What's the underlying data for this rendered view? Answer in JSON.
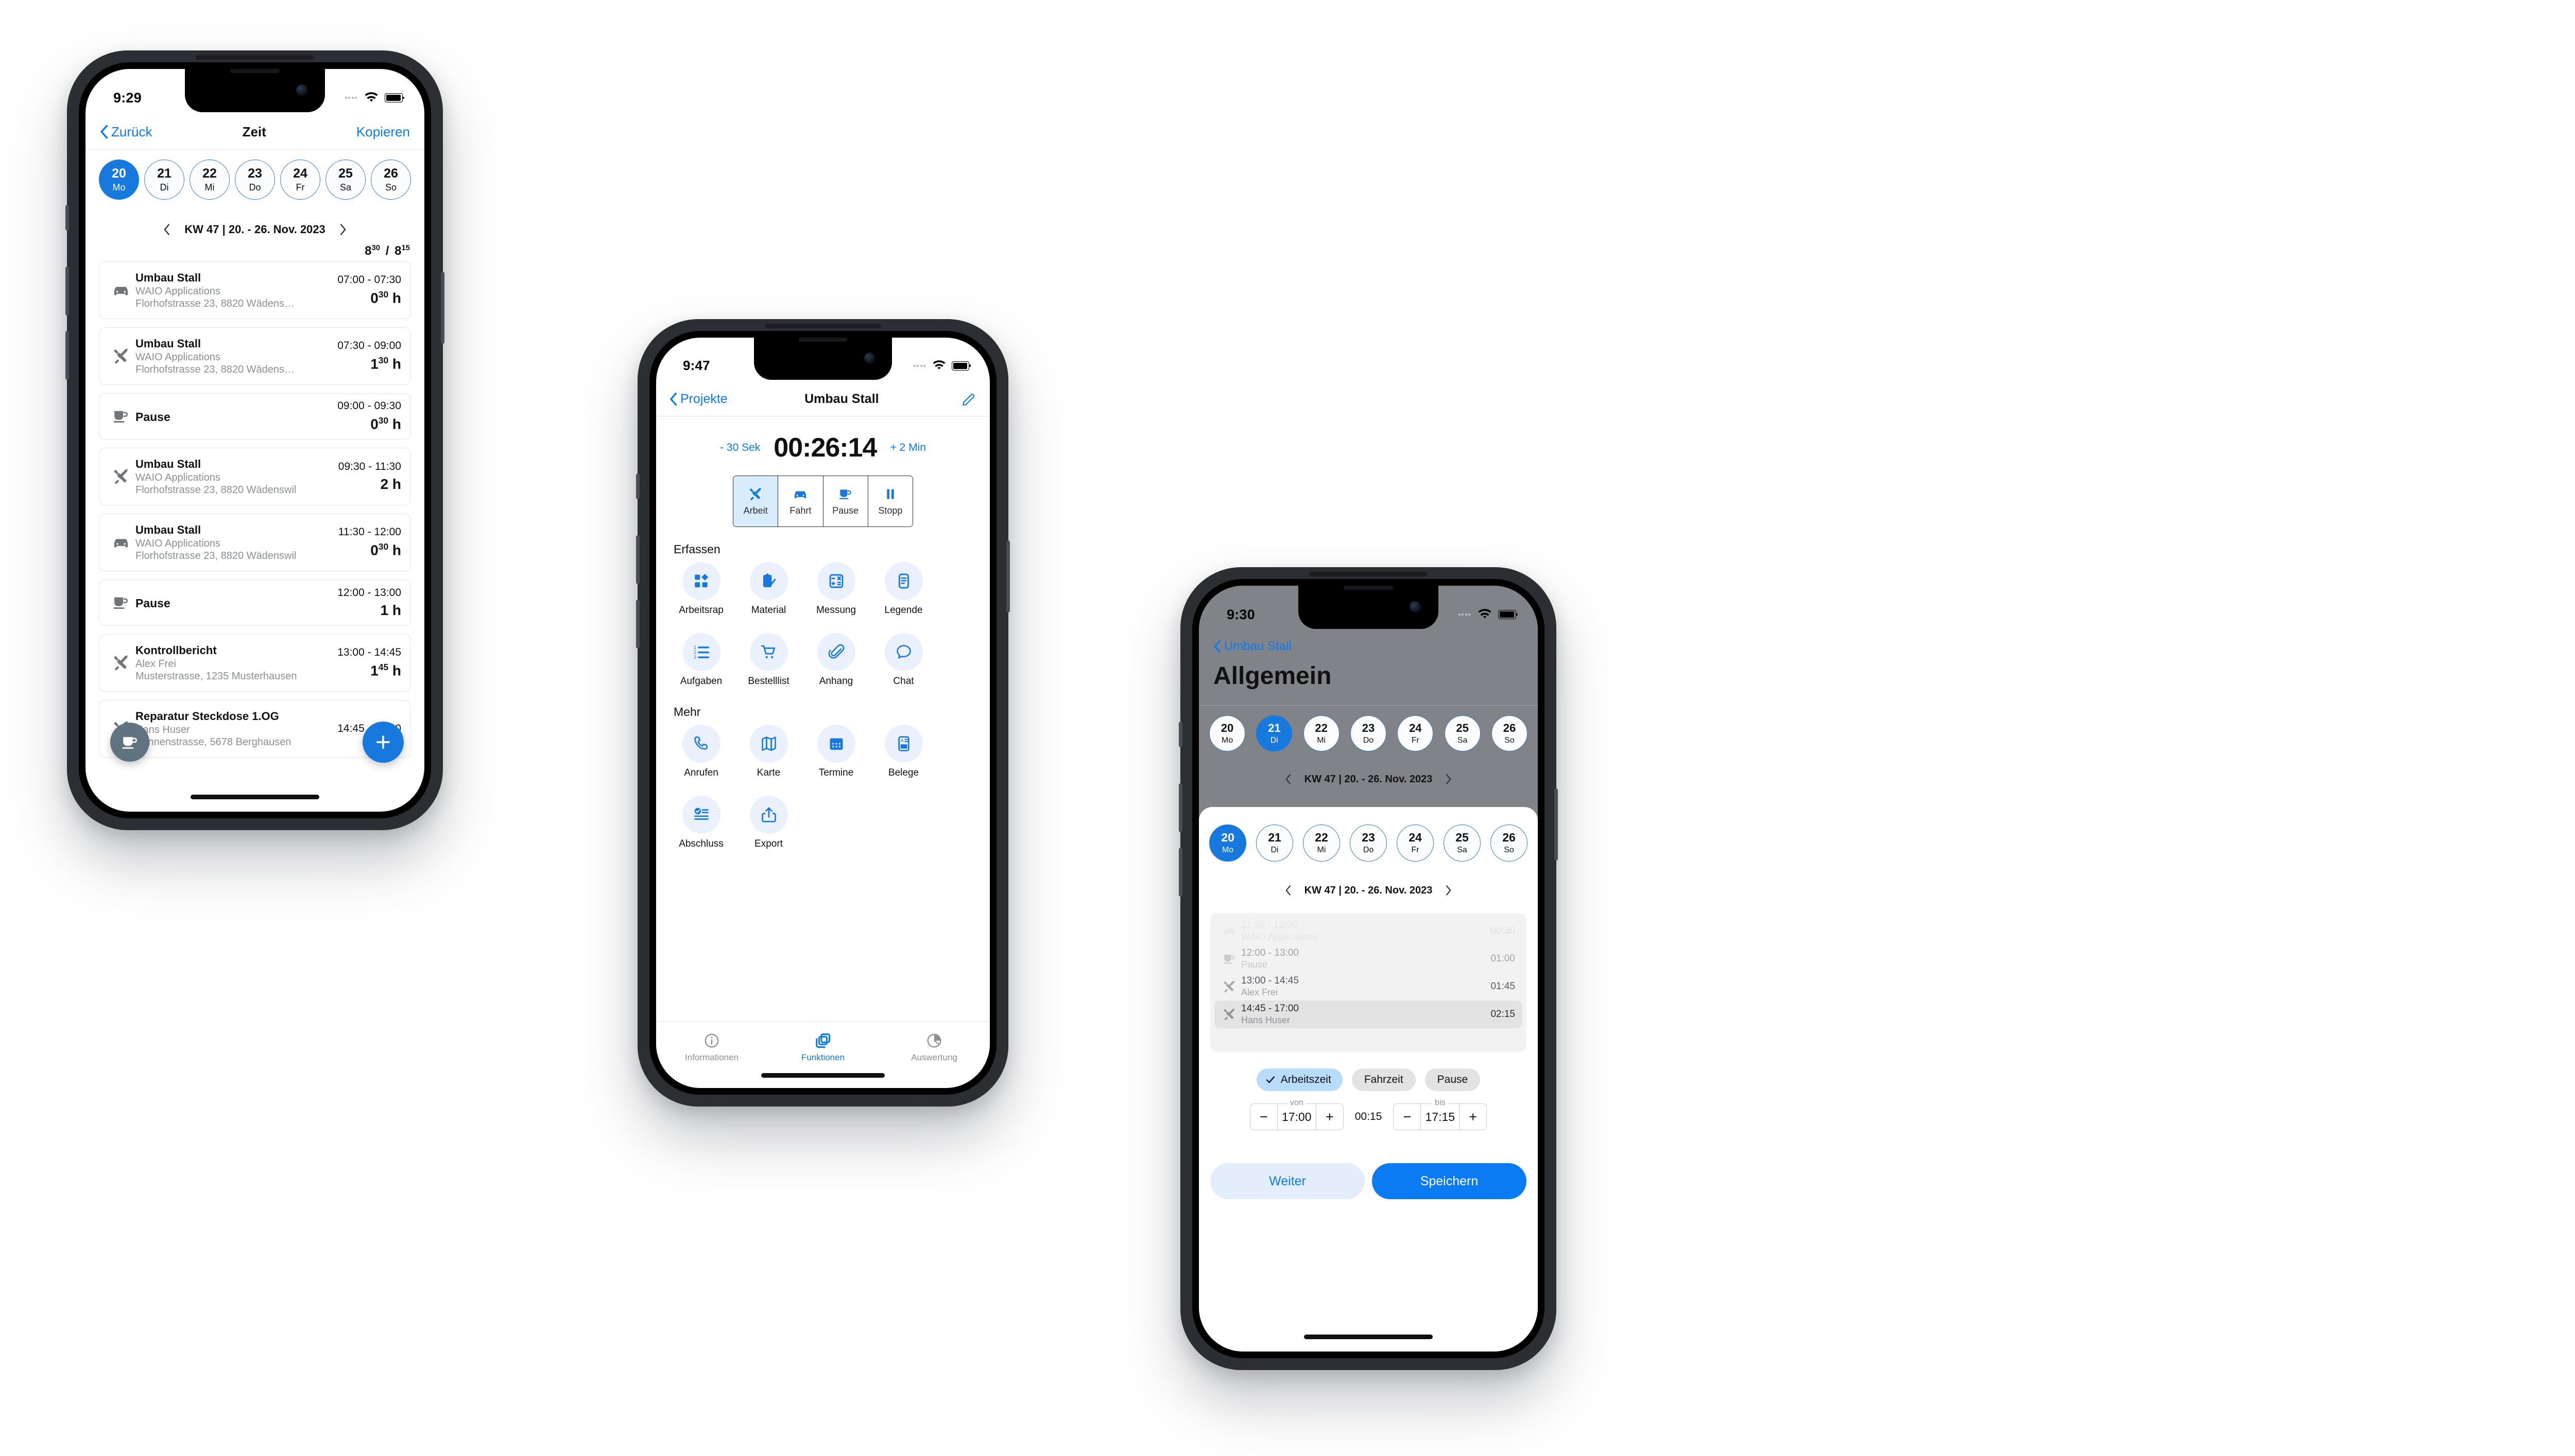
{
  "phone1": {
    "status": {
      "time": "9:29"
    },
    "nav": {
      "back": "Zurück",
      "title": "Zeit",
      "action": "Kopieren"
    },
    "days": [
      {
        "num": "20",
        "wd": "Mo",
        "active": true
      },
      {
        "num": "21",
        "wd": "Di",
        "active": false
      },
      {
        "num": "22",
        "wd": "Mi",
        "active": false
      },
      {
        "num": "23",
        "wd": "Do",
        "active": false
      },
      {
        "num": "24",
        "wd": "Fr",
        "active": false
      },
      {
        "num": "25",
        "wd": "Sa",
        "active": false
      },
      {
        "num": "26",
        "wd": "So",
        "active": false
      }
    ],
    "week": "KW 47 | 20. - 26. Nov. 2023",
    "summary": {
      "actual": "8",
      "actual_sup": "30",
      "sep": "/",
      "target": "8",
      "target_sup": "15"
    },
    "entries": [
      {
        "icon": "car-icon",
        "title": "Umbau Stall",
        "sub": "WAIO Applications",
        "addr": "Florhofstrasse 23, 8820 Wädens…",
        "range": "07:00 - 07:30",
        "dur": "0",
        "dur_sup": "30",
        "unit": "h"
      },
      {
        "icon": "tools-icon",
        "title": "Umbau Stall",
        "sub": "WAIO Applications",
        "addr": "Florhofstrasse 23, 8820 Wädens…",
        "range": "07:30 - 09:00",
        "dur": "1",
        "dur_sup": "30",
        "unit": "h"
      },
      {
        "icon": "cup-icon",
        "title": "Pause",
        "sub": "",
        "addr": "",
        "range": "09:00 - 09:30",
        "dur": "0",
        "dur_sup": "30",
        "unit": "h"
      },
      {
        "icon": "tools-icon",
        "title": "Umbau Stall",
        "sub": "WAIO Applications",
        "addr": "Florhofstrasse 23, 8820 Wädenswil",
        "range": "09:30 - 11:30",
        "dur": "2",
        "dur_sup": "",
        "unit": "h"
      },
      {
        "icon": "car-icon",
        "title": "Umbau Stall",
        "sub": "WAIO Applications",
        "addr": "Florhofstrasse 23, 8820 Wädenswil",
        "range": "11:30 - 12:00",
        "dur": "0",
        "dur_sup": "30",
        "unit": "h"
      },
      {
        "icon": "cup-icon",
        "title": "Pause",
        "sub": "",
        "addr": "",
        "range": "12:00 - 13:00",
        "dur": "1",
        "dur_sup": "",
        "unit": "h"
      },
      {
        "icon": "tools-icon",
        "title": "Kontrollbericht",
        "sub": "Alex Frei",
        "addr": "Musterstrasse, 1235 Musterhausen",
        "range": "13:00 - 14:45",
        "dur": "1",
        "dur_sup": "45",
        "unit": "h"
      },
      {
        "icon": "tools-icon",
        "title": "Reparatur Steckdose 1.OG",
        "sub": "Hans Huser",
        "addr": "Sonnenstrasse, 5678 Berghausen",
        "range": "14:45 - 17:00",
        "dur": "",
        "dur_sup": "",
        "unit": ""
      }
    ],
    "fab_pause": "pause-fab",
    "fab_add": "+"
  },
  "phone2": {
    "status": {
      "time": "9:47"
    },
    "nav": {
      "back": "Projekte",
      "title": "Umbau Stall",
      "action_icon": "pencil-icon"
    },
    "timer": {
      "minus": "- 30 Sek",
      "value": "00:26:14",
      "plus": "+ 2 Min"
    },
    "modes": [
      {
        "label": "Arbeit",
        "icon": "tools-icon",
        "active": true
      },
      {
        "label": "Fahrt",
        "icon": "car-icon",
        "active": false
      },
      {
        "label": "Pause",
        "icon": "cup-icon",
        "active": false
      },
      {
        "label": "Stopp",
        "icon": "pause-icon",
        "active": false
      }
    ],
    "section_erfassen": "Erfassen",
    "erfassen_items": [
      {
        "label": "Arbeitsrap",
        "icon": "blocks-icon"
      },
      {
        "label": "Material",
        "icon": "clipboard-check-icon"
      },
      {
        "label": "Messung",
        "icon": "calculator-icon"
      },
      {
        "label": "Legende",
        "icon": "document-icon"
      },
      {
        "label": "Aufgaben",
        "icon": "numbered-list-icon"
      },
      {
        "label": "Bestelllist",
        "icon": "cart-icon"
      },
      {
        "label": "Anhang",
        "icon": "paperclip-icon"
      },
      {
        "label": "Chat",
        "icon": "chat-bubble-icon"
      }
    ],
    "section_mehr": "Mehr",
    "mehr_items": [
      {
        "label": "Anrufen",
        "icon": "phone-icon"
      },
      {
        "label": "Karte",
        "icon": "map-icon"
      },
      {
        "label": "Termine",
        "icon": "calendar-icon"
      },
      {
        "label": "Belege",
        "icon": "receipt-icon"
      },
      {
        "label": "Abschluss",
        "icon": "checklist-icon"
      },
      {
        "label": "Export",
        "icon": "share-icon"
      }
    ],
    "tabs": [
      {
        "label": "Informationen",
        "icon": "info-icon",
        "active": false
      },
      {
        "label": "Funktionen",
        "icon": "layers-icon",
        "active": true
      },
      {
        "label": "Auswertung",
        "icon": "pie-chart-icon",
        "active": false
      }
    ]
  },
  "phone3": {
    "status": {
      "time": "9:30"
    },
    "nav": {
      "back": "Umbau Stall"
    },
    "large_title": "Allgemein",
    "bg_days": [
      {
        "num": "20",
        "wd": "Mo",
        "active": false
      },
      {
        "num": "21",
        "wd": "Di",
        "active": true
      },
      {
        "num": "22",
        "wd": "Mi",
        "active": false
      },
      {
        "num": "23",
        "wd": "Do",
        "active": false
      },
      {
        "num": "24",
        "wd": "Fr",
        "active": false
      },
      {
        "num": "25",
        "wd": "Sa",
        "active": false
      },
      {
        "num": "26",
        "wd": "So",
        "active": false
      }
    ],
    "bg_week": "KW 47 | 20. - 26. Nov. 2023",
    "sheet_days": [
      {
        "num": "20",
        "wd": "Mo",
        "active": true
      },
      {
        "num": "21",
        "wd": "Di",
        "active": false
      },
      {
        "num": "22",
        "wd": "Mi",
        "active": false
      },
      {
        "num": "23",
        "wd": "Do",
        "active": false
      },
      {
        "num": "24",
        "wd": "Fr",
        "active": false
      },
      {
        "num": "25",
        "wd": "Sa",
        "active": false
      },
      {
        "num": "26",
        "wd": "So",
        "active": false
      }
    ],
    "sheet_week": "KW 47 | 20. - 26. Nov. 2023",
    "rows": [
      {
        "icon": "car-icon",
        "l1": "11:30 - 12:00",
        "l2": "WAIO Applications",
        "r": "00:30",
        "selected": false,
        "fade": 0.16
      },
      {
        "icon": "cup-icon",
        "l1": "12:00 - 13:00",
        "l2": "Pause",
        "r": "01:00",
        "selected": false,
        "fade": 0.4
      },
      {
        "icon": "tools-icon",
        "l1": "13:00 - 14:45",
        "l2": "Alex Frei",
        "r": "01:45",
        "selected": false,
        "fade": 0.78
      },
      {
        "icon": "tools-icon",
        "l1": "14:45 - 17:00",
        "l2": "Hans Huser",
        "r": "02:15",
        "selected": true,
        "fade": 1
      }
    ],
    "chips": [
      {
        "label": "Arbeitszeit",
        "on": true,
        "check": true
      },
      {
        "label": "Fahrzeit",
        "on": false,
        "check": false
      },
      {
        "label": "Pause",
        "on": false,
        "check": false
      }
    ],
    "steppers": {
      "from": {
        "caption": "von",
        "minus": "−",
        "value": "17:00",
        "plus": "+"
      },
      "delta": "00:15",
      "to": {
        "caption": "bis",
        "minus": "−",
        "value": "17:15",
        "plus": "+"
      }
    },
    "buttons": {
      "secondary": "Weiter",
      "primary": "Speichern"
    }
  },
  "colors": {
    "accent_blue": "#0a7bf2",
    "pill_blue": "#1779dd",
    "chip_blue": "#b8dcfb",
    "bezel": "#2b2e33",
    "dim": "#808387"
  }
}
